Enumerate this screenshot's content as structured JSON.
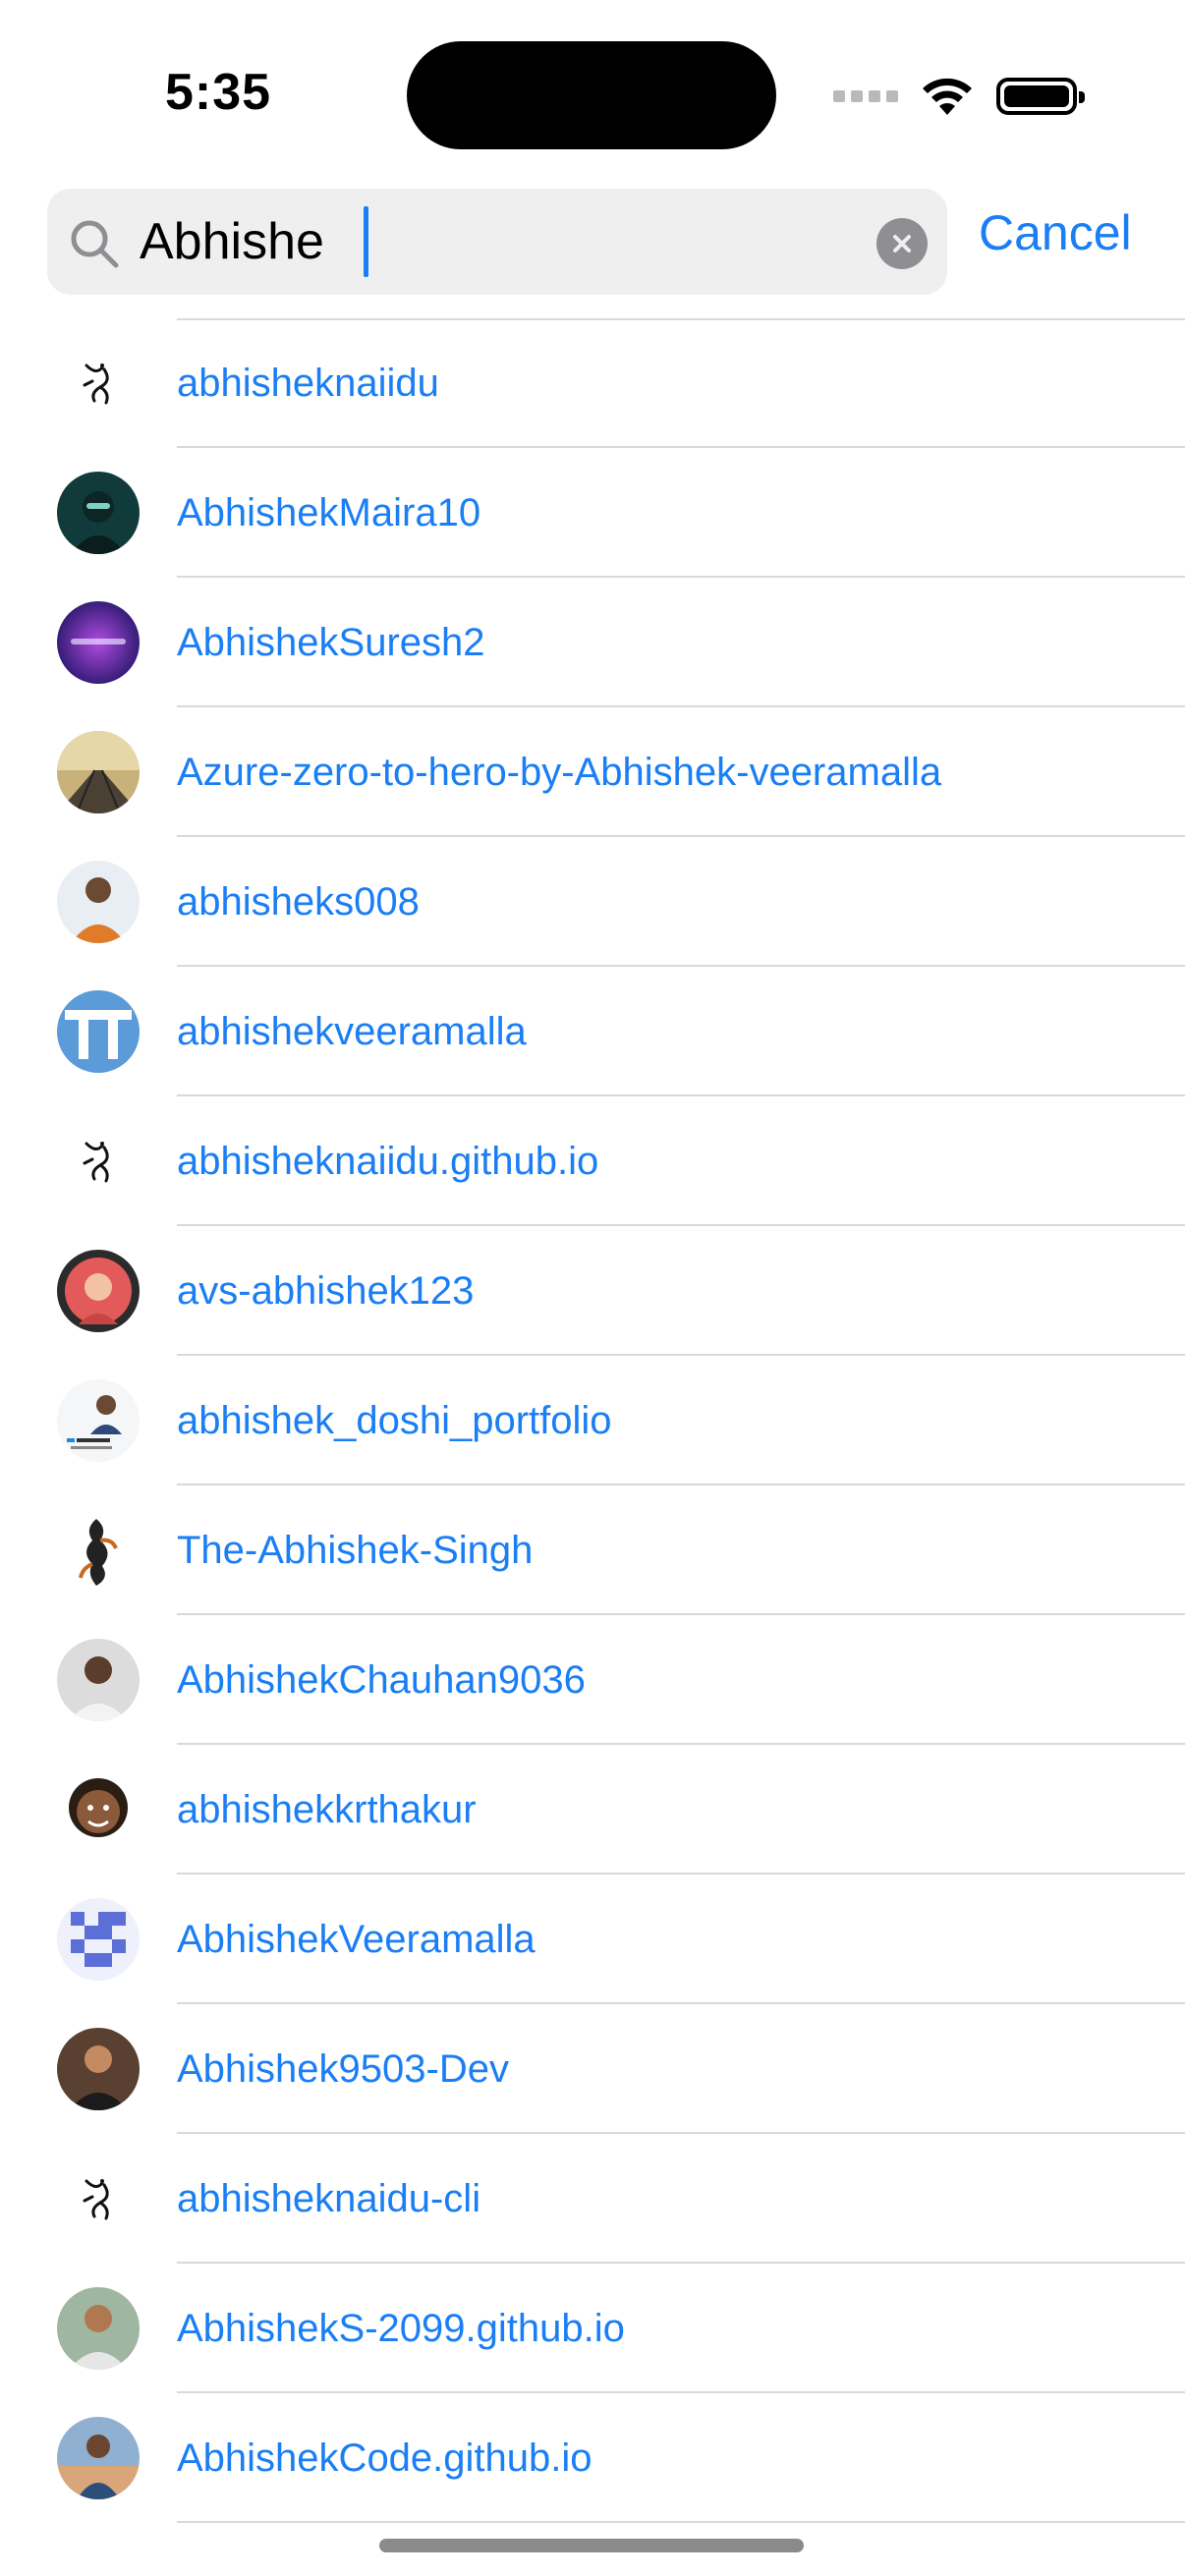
{
  "status_bar": {
    "time": "5:35"
  },
  "search": {
    "value": "Abhishe",
    "cancel_label": "Cancel"
  },
  "results": [
    {
      "label": "abhisheknaiidu",
      "avatar": "logo-sketch"
    },
    {
      "label": "AbhishekMaira10",
      "avatar": "photo-dark"
    },
    {
      "label": "AbhishekSuresh2",
      "avatar": "purple-gradient"
    },
    {
      "label": "Azure-zero-to-hero-by-Abhishek-veeramalla",
      "avatar": "railway-photo"
    },
    {
      "label": "abhisheks008",
      "avatar": "person-orange"
    },
    {
      "label": "abhishekveeramalla",
      "avatar": "blue-identicon"
    },
    {
      "label": "abhisheknaiidu.github.io",
      "avatar": "logo-sketch"
    },
    {
      "label": "avs-abhishek123",
      "avatar": "person-red"
    },
    {
      "label": "abhishek_doshi_portfolio",
      "avatar": "person-banner"
    },
    {
      "label": "The-Abhishek-Singh",
      "avatar": "ink-figure"
    },
    {
      "label": "AbhishekChauhan9036",
      "avatar": "person-grey"
    },
    {
      "label": "abhishekkrthakur",
      "avatar": "cartoon-face"
    },
    {
      "label": "AbhishekVeeramalla",
      "avatar": "blue-pixel-identicon"
    },
    {
      "label": "Abhishek9503-Dev",
      "avatar": "person-dark"
    },
    {
      "label": "abhisheknaidu-cli",
      "avatar": "logo-sketch"
    },
    {
      "label": "AbhishekS-2099.github.io",
      "avatar": "person-outdoor"
    },
    {
      "label": "AbhishekCode.github.io",
      "avatar": "person-sunset"
    }
  ],
  "colors": {
    "accent": "#1a7ef5",
    "separator": "#d9d9dc",
    "search_bg": "#efefef"
  }
}
